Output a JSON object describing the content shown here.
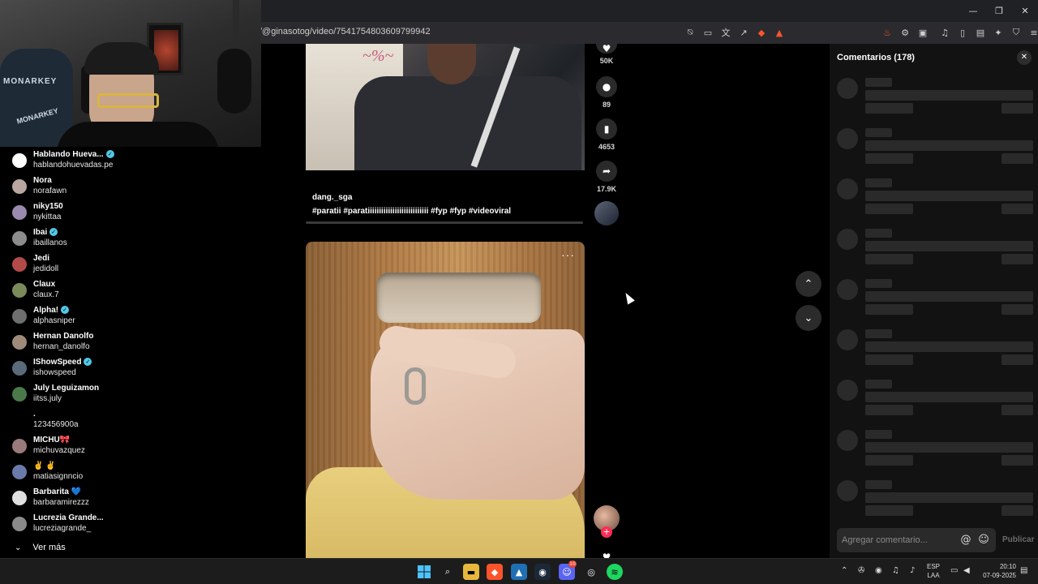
{
  "browser": {
    "url": "/@ginasotog/video/7541754803609799942",
    "window_controls": [
      "—",
      "❐",
      "✕"
    ],
    "toolbar_icons": [
      "reader-off-icon",
      "cast-icon",
      "translate-icon",
      "share-icon",
      "brave-shield-icon",
      "brave-rewards-icon",
      "extension-fire-icon",
      "puzzle-icon",
      "screenshot-icon",
      "media-icon",
      "sidebar-icon",
      "wallet-icon",
      "leo-icon",
      "vpn-icon",
      "menu-icon"
    ],
    "brand_color": "#fb542b"
  },
  "webcam": {
    "chair_brand": "MONARKEY"
  },
  "chat": {
    "users": [
      {
        "name": "Hablando Hueva...",
        "handle": "hablandohuevadas.pe",
        "verified": true,
        "color": "#ffffff"
      },
      {
        "name": "Nora",
        "handle": "norafawn",
        "verified": false,
        "color": "#b9a6a0"
      },
      {
        "name": "niky150",
        "handle": "nykittaa",
        "verified": false,
        "color": "#9a8ab0"
      },
      {
        "name": "Ibai",
        "handle": "ibaillanos",
        "verified": true,
        "color": "#8c8c8c"
      },
      {
        "name": "Jedi",
        "handle": "jedidoll",
        "verified": false,
        "color": "#b24a4a"
      },
      {
        "name": "Claux",
        "handle": "claux.7",
        "verified": false,
        "color": "#7a8a5a"
      },
      {
        "name": "Alpha!",
        "handle": "alphasniper",
        "verified": true,
        "color": "#6e6e6e"
      },
      {
        "name": "Hernan Danolfo",
        "handle": "hernan_danolfo",
        "verified": false,
        "color": "#a08a7a"
      },
      {
        "name": "IShowSpeed",
        "handle": "ishowspeed",
        "verified": true,
        "color": "#5a6a7a"
      },
      {
        "name": "July Leguizamon",
        "handle": "iitss.july",
        "verified": false,
        "color": "#4a7a4a"
      },
      {
        "name": ".",
        "handle": "123456900a",
        "verified": false,
        "color": "#000000"
      },
      {
        "name": "MICHU🎀",
        "handle": "michuvazquez",
        "verified": false,
        "color": "#9a7a7a"
      },
      {
        "name": "✌️ ✌️",
        "handle": "matiasignncio",
        "verified": false,
        "color": "#6a7aaa"
      },
      {
        "name": "Barbarita 💙",
        "handle": "barbaramirezzz",
        "verified": false,
        "color": "#e0e0e0"
      },
      {
        "name": "Lucrezia Grande...",
        "handle": "lucreziagrande_",
        "verified": false,
        "color": "#8a8a8a"
      }
    ],
    "see_more": "Ver más"
  },
  "feed": {
    "video1": {
      "username": "dang._sga",
      "hashtags": "#paratii  #paratiiiiiiiiiiiiiiiiiiiiiiiiiii  #fyp  #fyp  #videoviral",
      "likes": "50K",
      "comments": "89",
      "saves": "4653",
      "shares": "17.9K"
    },
    "video2": {
      "more_label": "···"
    }
  },
  "nav": {
    "up": "⌃",
    "down": "⌄"
  },
  "comments_panel": {
    "title": "Comentarios (178)",
    "close": "✕",
    "skeleton_count": 9,
    "input_placeholder": "Agregar comentario...",
    "mention_icon": "@",
    "emoji_icon": "☺",
    "publish": "Publicar"
  },
  "taskbar": {
    "language_top": "ESP",
    "language_bottom": "LAA",
    "time": "20:10",
    "date": "07-09-2025",
    "discord_badge": "10"
  }
}
